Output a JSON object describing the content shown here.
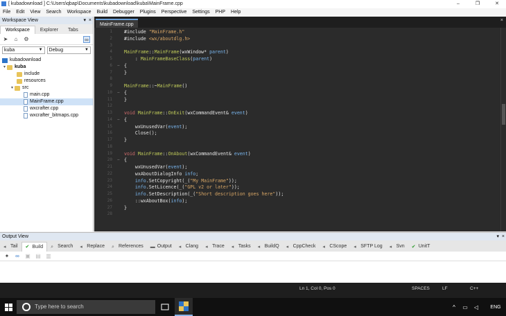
{
  "window": {
    "title": "[ kubadownload ] C:\\Users\\qbap\\Documents\\kubadownload\\kuba\\MainFrame.cpp",
    "controls": [
      "–",
      "❐",
      "✕"
    ]
  },
  "menu": [
    "File",
    "Edit",
    "View",
    "Search",
    "Workspace",
    "Build",
    "Debugger",
    "Plugins",
    "Perspective",
    "Settings",
    "PHP",
    "Help"
  ],
  "workspace_view": {
    "title": "Workspace View",
    "tabs": [
      "Workspace",
      "Explorer",
      "Tabs"
    ],
    "project_select": "kuba",
    "config_select": "Debug",
    "tree": {
      "workspace": "kubadownload",
      "project": "kuba",
      "folders": [
        "include",
        "resources",
        "src"
      ],
      "files": [
        "main.cpp",
        "MainFrame.cpp",
        "wxcrafter.cpp",
        "wxcrafter_bitmaps.cpp"
      ]
    }
  },
  "editor": {
    "tab": "MainFrame.cpp",
    "line_numbers": [
      "1",
      "2",
      "3",
      "4",
      "5",
      "6",
      "7",
      "8",
      "9",
      "10",
      "11",
      "12",
      "13",
      "14",
      "15",
      "16",
      "17",
      "18",
      "19",
      "20",
      "21",
      "22",
      "23",
      "24",
      "25",
      "26",
      "27",
      "28"
    ]
  },
  "output_view": {
    "title": "Output View",
    "tabs": [
      "Tail",
      "Build",
      "Search",
      "Replace",
      "References",
      "Output",
      "Clang",
      "Trace",
      "Tasks",
      "BuildQ",
      "CppCheck",
      "CScope",
      "SFTP Log",
      "Svn",
      "UnitT"
    ]
  },
  "status": {
    "position": "Ln 1, Col 0, Pos 0",
    "indent": "SPACES",
    "eol": "LF",
    "lang": "C++"
  },
  "taskbar": {
    "search_placeholder": "Type here to search",
    "language": "ENG"
  }
}
